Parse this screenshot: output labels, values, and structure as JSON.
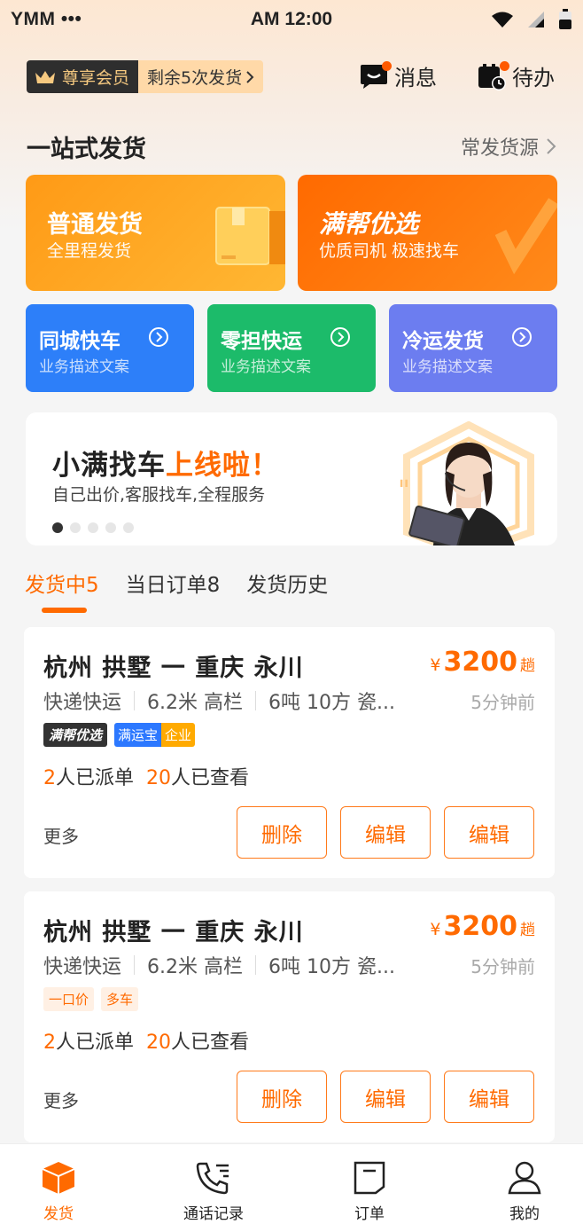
{
  "status_bar": {
    "carrier": "YMM •••",
    "time": "AM 12:00"
  },
  "membership": {
    "badge": "尊享会员",
    "remaining": "剩余5次发货"
  },
  "top_actions": {
    "messages": "消息",
    "todo": "待办"
  },
  "section": {
    "title": "一站式发货",
    "more": "常发货源"
  },
  "big_cards": [
    {
      "title": "普通发货",
      "subtitle": "全里程发货"
    },
    {
      "title": "满帮优选",
      "subtitle": "优质司机 极速找车"
    }
  ],
  "small_cards": [
    {
      "title": "同城快车",
      "subtitle": "业务描述文案"
    },
    {
      "title": "零担快运",
      "subtitle": "业务描述文案"
    },
    {
      "title": "冷运发货",
      "subtitle": "业务描述文案"
    }
  ],
  "banner": {
    "title_main": "小满找车",
    "title_highlight": "上线啦！",
    "subtitle": "自己出价,客服找车,全程服务"
  },
  "tabs": [
    "发货中5",
    "当日订单8",
    "发货历史"
  ],
  "orders": [
    {
      "route": "杭州 拱墅 一 重庆 永川",
      "price_symbol": "¥",
      "price": "3200",
      "price_unit": "趟",
      "info": [
        "快递快运",
        "6.2米 高栏",
        "6吨 10方 瓷..."
      ],
      "ago": "5分钟前",
      "tag_dark": "满帮优选",
      "tag_blue_a": "满运宝",
      "tag_blue_b": "企业",
      "dispatch_num": "2",
      "dispatch_label": "人已派单",
      "view_num": "20",
      "view_label": "人已查看",
      "more": "更多",
      "buttons": [
        "删除",
        "编辑",
        "编辑"
      ]
    },
    {
      "route": "杭州 拱墅 一 重庆 永川",
      "price_symbol": "¥",
      "price": "3200",
      "price_unit": "趟",
      "info": [
        "快递快运",
        "6.2米 高栏",
        "6吨 10方 瓷..."
      ],
      "ago": "5分钟前",
      "tags": [
        "一口价",
        "多车"
      ],
      "dispatch_num": "2",
      "dispatch_label": "人已派单",
      "view_num": "20",
      "view_label": "人已查看",
      "more": "更多",
      "buttons": [
        "删除",
        "编辑",
        "编辑"
      ]
    }
  ],
  "nav": [
    "发货",
    "通话记录",
    "订单",
    "我的"
  ],
  "colors": {
    "accent": "#ff6a00",
    "blue": "#2d7ff9",
    "green": "#1cbb6a",
    "purple": "#6c7df0"
  }
}
